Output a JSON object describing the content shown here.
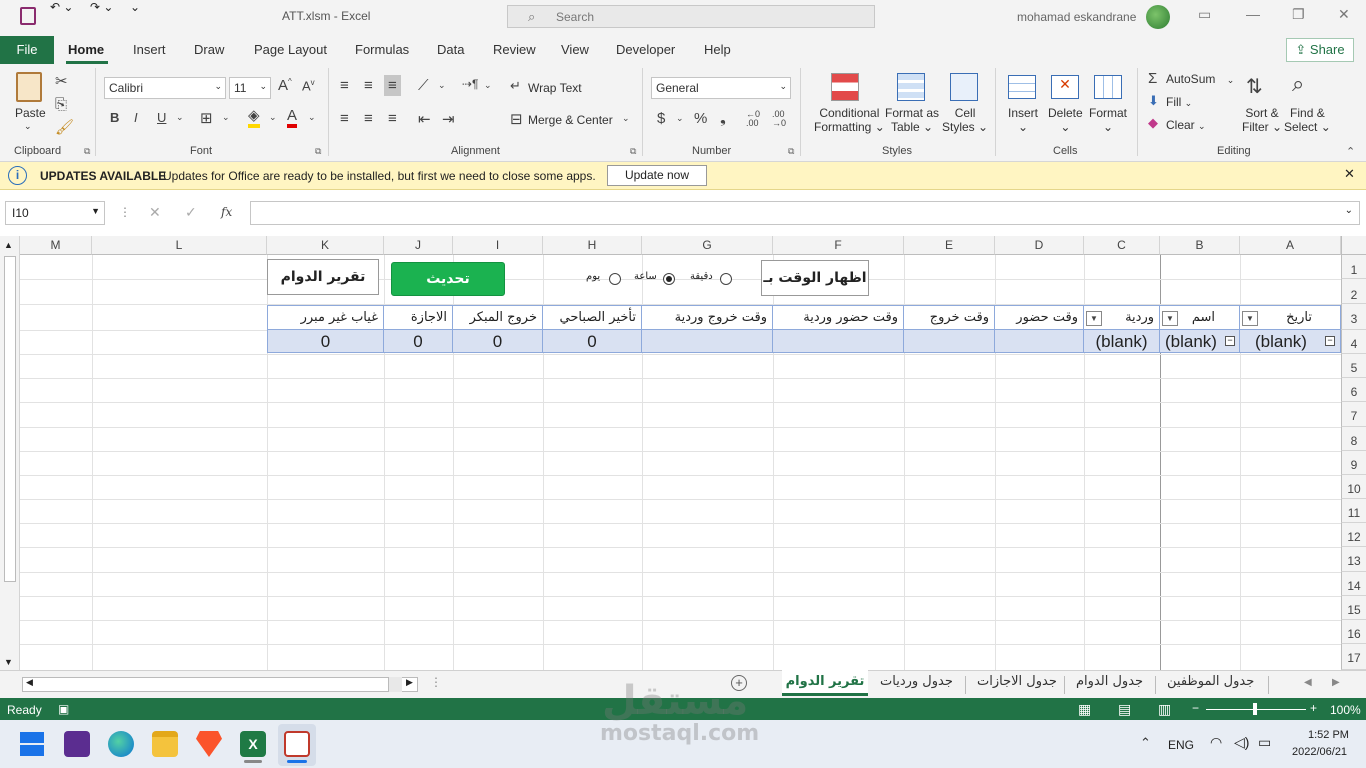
{
  "window": {
    "title": "ATT.xlsm  -  Excel",
    "search_placeholder": "Search",
    "user": "mohamad eskandrane"
  },
  "tabs": [
    "File",
    "Home",
    "Insert",
    "Draw",
    "Page Layout",
    "Formulas",
    "Data",
    "Review",
    "View",
    "Developer",
    "Help"
  ],
  "share_label": "Share",
  "ribbon": {
    "clipboard": {
      "paste": "Paste",
      "group": "Clipboard"
    },
    "font": {
      "name": "Calibri",
      "size": "11",
      "group": "Font"
    },
    "alignment": {
      "wrap": "Wrap Text",
      "merge": "Merge & Center",
      "group": "Alignment"
    },
    "number": {
      "format": "General",
      "group": "Number"
    },
    "styles": {
      "conditional": "Conditional",
      "conditional2": "Formatting",
      "format_table": "Format as",
      "format_table2": "Table",
      "cell_styles": "Cell",
      "cell_styles2": "Styles",
      "group": "Styles"
    },
    "cells": {
      "insert": "Insert",
      "delete": "Delete",
      "format": "Format",
      "group": "Cells"
    },
    "editing": {
      "autosum": "AutoSum",
      "fill": "Fill",
      "clear": "Clear",
      "sort": "Sort &",
      "sort2": "Filter",
      "find": "Find &",
      "find2": "Select",
      "group": "Editing"
    }
  },
  "infobar": {
    "title": "UPDATES AVAILABLE",
    "message": "Updates for Office are ready to be installed, but first we need to close some apps.",
    "button": "Update now"
  },
  "namebox": "I10",
  "columns": [
    "M",
    "L",
    "K",
    "J",
    "I",
    "H",
    "G",
    "F",
    "E",
    "D",
    "C",
    "B",
    "A"
  ],
  "rows": [
    "1",
    "2",
    "3",
    "4",
    "5",
    "6",
    "7",
    "8",
    "9",
    "10",
    "11",
    "12",
    "13",
    "14",
    "15",
    "16",
    "17"
  ],
  "sheet": {
    "report_button": "تقرير الدوام",
    "refresh_button": "تحديث",
    "show_time_button": "اظهار الوقت بـ",
    "radio": {
      "day": "يوم",
      "hour": "ساعة",
      "minute": "دقيقة",
      "selected": "ساعة"
    },
    "headers": {
      "A": "تاريخ",
      "B": "اسم",
      "C": "وردية",
      "D": "وقت حضور",
      "E": "وقت خروج",
      "F": "وقت حضور وردية",
      "G": "وقت خروج وردية",
      "H": "تأخير الصباحي",
      "I": "خروج المبكر",
      "J": "الاجازة",
      "K": "غياب غير مبرر"
    },
    "row4": {
      "A": "(blank)",
      "B": "(blank)",
      "C": "(blank)",
      "H": "0",
      "I": "0",
      "J": "0",
      "K": "0"
    }
  },
  "sheet_tabs": [
    "تقرير الدوام",
    "جدول ورديات",
    "جدول الاجازات",
    "جدول الدوام",
    "جدول الموظفين"
  ],
  "status": {
    "ready": "Ready",
    "zoom": "100%"
  },
  "taskbar": {
    "lang": "ENG",
    "time": "1:52 PM",
    "date": "2022/06/21"
  },
  "watermark": {
    "arabic": "مستقل",
    "latin": "mostaql.com"
  },
  "colors": {
    "excel_green": "#217346",
    "refresh_green": "#1bb250",
    "table_fill": "#d9e1f2",
    "info_bg": "#fff5c2"
  }
}
